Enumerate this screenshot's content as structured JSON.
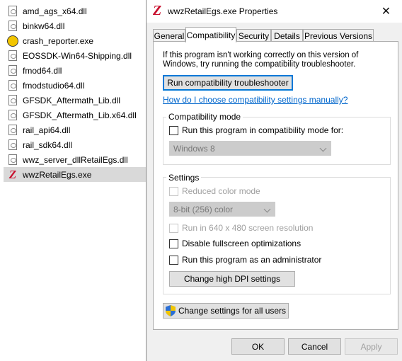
{
  "files": [
    {
      "name": "amd_ags_x64.dll",
      "icon": "dll-file-icon"
    },
    {
      "name": "binkw64.dll",
      "icon": "dll-file-icon"
    },
    {
      "name": "crash_reporter.exe",
      "icon": "crash-reporter-icon"
    },
    {
      "name": "EOSSDK-Win64-Shipping.dll",
      "icon": "dll-file-icon"
    },
    {
      "name": "fmod64.dll",
      "icon": "dll-file-icon"
    },
    {
      "name": "fmodstudio64.dll",
      "icon": "dll-file-icon"
    },
    {
      "name": "GFSDK_Aftermath_Lib.dll",
      "icon": "dll-file-icon"
    },
    {
      "name": "GFSDK_Aftermath_Lib.x64.dll",
      "icon": "dll-file-icon"
    },
    {
      "name": "rail_api64.dll",
      "icon": "dll-file-icon"
    },
    {
      "name": "rail_sdk64.dll",
      "icon": "dll-file-icon"
    },
    {
      "name": "wwz_server_dllRetailEgs.dll",
      "icon": "dll-file-icon"
    },
    {
      "name": "wwzRetailEgs.exe",
      "icon": "z-app-icon",
      "selected": true
    }
  ],
  "dialog": {
    "title": "wwzRetailEgs.exe Properties",
    "title_icon_glyph": "Z",
    "close_glyph": "✕",
    "tabs": [
      {
        "label": "General"
      },
      {
        "label": "Compatibility",
        "active": true
      },
      {
        "label": "Security"
      },
      {
        "label": "Details"
      },
      {
        "label": "Previous Versions"
      }
    ],
    "intro_text": "If this program isn't working correctly on this version of Windows, try running the compatibility troubleshooter.",
    "run_troubleshooter_label": "Run compatibility troubleshooter",
    "manual_link": "How do I choose compatibility settings manually?",
    "compat_mode": {
      "group_label": "Compatibility mode",
      "checkbox_label": "Run this program in compatibility mode for:",
      "checked": false,
      "os_select_value": "Windows 8"
    },
    "settings": {
      "group_label": "Settings",
      "reduced_color_label": "Reduced color mode",
      "color_select_value": "8-bit (256) color",
      "resolution_label": "Run in 640 x 480 screen resolution",
      "disable_fullscreen_label": "Disable fullscreen optimizations",
      "run_as_admin_label": "Run this program as an administrator",
      "dpi_button_label": "Change high DPI settings"
    },
    "change_all_users_label": "Change settings for all users",
    "ok_label": "OK",
    "cancel_label": "Cancel",
    "apply_label": "Apply"
  },
  "colors": {
    "link": "#0066cc",
    "focus": "#0078d7",
    "app_icon_red": "#c8102e",
    "selection_gray": "#d9d9d9"
  }
}
